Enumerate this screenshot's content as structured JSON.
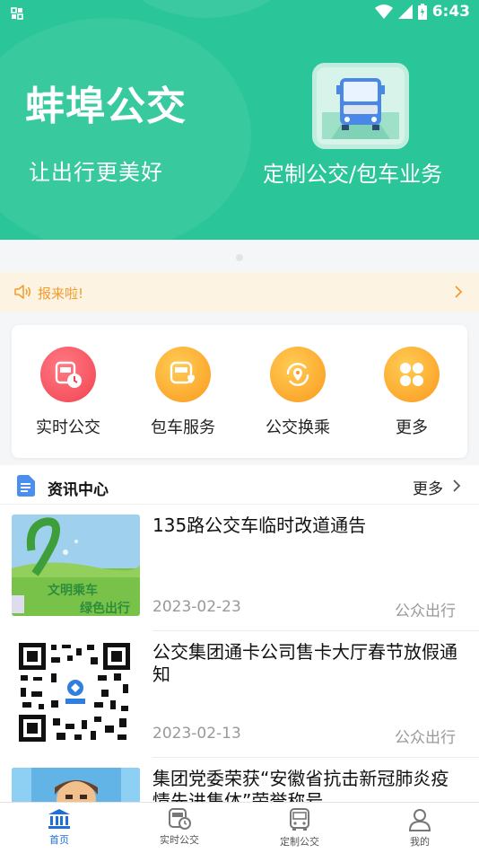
{
  "status_bar": {
    "time": "6:43"
  },
  "banner": {
    "title": "蚌埠公交",
    "subtitle": "让出行更美好",
    "service_label": "定制公交/包车业务"
  },
  "notice": {
    "text": "报来啦!"
  },
  "quick_menu": [
    {
      "label": "实时公交",
      "icon": "realtime-bus-icon",
      "color": "#f1434f"
    },
    {
      "label": "包车服务",
      "icon": "charter-bus-icon",
      "color": "#fb9a1d"
    },
    {
      "label": "公交换乘",
      "icon": "transfer-icon",
      "color": "#fb9a1d"
    },
    {
      "label": "更多",
      "icon": "more-grid-icon",
      "color": "#fb9a1d"
    }
  ],
  "news": {
    "title": "资讯中心",
    "more_label": "更多",
    "items": [
      {
        "title": "135路公交车临时改道通告",
        "date": "2023-02-23",
        "source": "公众出行",
        "thumb_text": [
          "文明乘车",
          "绿色出行"
        ]
      },
      {
        "title": "公交集团通卡公司售卡大厅春节放假通知",
        "date": "2023-02-13",
        "source": "公众出行"
      },
      {
        "title": "集团党委荣获“安徽省抗击新冠肺炎疫情先进集体”荣誉称号",
        "date": "",
        "source": ""
      }
    ]
  },
  "tabbar": [
    {
      "label": "首页",
      "icon": "home-icon",
      "active": true
    },
    {
      "label": "实时公交",
      "icon": "realtime-bus-icon",
      "active": false
    },
    {
      "label": "定制公交",
      "icon": "bus-icon",
      "active": false
    },
    {
      "label": "我的",
      "icon": "profile-icon",
      "active": false
    }
  ],
  "colors": {
    "brand_green": "#2ac598",
    "notice_orange": "#f39c2a",
    "tab_active": "#1e6fdc"
  }
}
